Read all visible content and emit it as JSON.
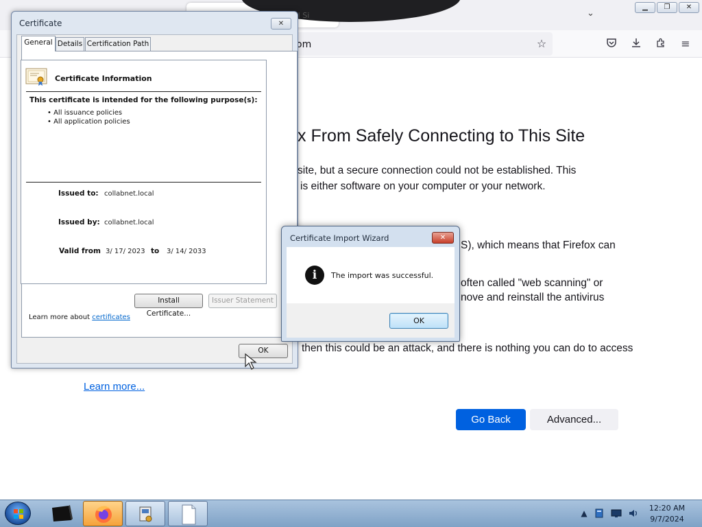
{
  "browser": {
    "tab_title": "al Si",
    "url_text": "om",
    "icons": [
      "star-icon",
      "pocket-icon",
      "download-icon",
      "extensions-icon",
      "menu-icon",
      "tab-list-icon"
    ],
    "window_buttons": {
      "minimize": "▁",
      "restore": "❐",
      "close": "✕"
    }
  },
  "error_page": {
    "title": "x From Safely Connecting to This Site",
    "paragraph1_line1": "site, but a secure connection could not be established. This",
    "paragraph1_line2": "is either software on your computer or your network.",
    "paragraph2": "S), which means that Firefox can",
    "paragraph3_line1": "often called \"web scanning\" or",
    "paragraph3_line2": "nove and reinstall the antivirus",
    "paragraph4": "then this could be an attack, and there is nothing you can do to access",
    "learn_more": "Learn more...",
    "go_back": "Go Back",
    "advanced": "Advanced..."
  },
  "certificate_dialog": {
    "title": "Certificate",
    "close_glyph": "✕",
    "tabs": [
      {
        "label": "General",
        "active": true
      },
      {
        "label": "Details",
        "active": false
      },
      {
        "label": "Certification Path",
        "active": false
      }
    ],
    "info_heading": "Certificate Information",
    "purpose_heading": "This certificate is intended for the following purpose(s):",
    "purposes": [
      "• All issuance policies",
      "• All application policies"
    ],
    "issued_to_label": "Issued to:",
    "issued_to_value": "collabnet.local",
    "issued_by_label": "Issued by:",
    "issued_by_value": "collabnet.local",
    "valid_from_label": "Valid from",
    "valid_from_value": "3/ 17/ 2023",
    "valid_to_label": "to",
    "valid_to_value": "3/ 14/ 2033",
    "install_button": "Install Certificate...",
    "issuer_statement_button": "Issuer Statement",
    "learn_more_prefix": "Learn more about ",
    "learn_more_link": "certificates",
    "ok_button": "OK"
  },
  "import_wizard": {
    "title": "Certificate Import Wizard",
    "close_glyph": "✕",
    "icon_glyph": "i",
    "message": "The import was successful.",
    "ok_button": "OK"
  },
  "taskbar": {
    "clock_time": "12:20 AM",
    "clock_date": "9/7/2024",
    "items": [
      "start-orb",
      "terminal-icon",
      "firefox-icon",
      "certificate-manager-icon",
      "document-icon"
    ],
    "tray_icons": [
      "show-hidden-icons-icon",
      "network-drive-icon",
      "display-icon",
      "volume-icon"
    ]
  },
  "colors": {
    "firefox_blue": "#0061e0",
    "dialog_frame": "#dfe7f1",
    "taskbar": "#a9c3de",
    "close_red": "#c8402b"
  }
}
